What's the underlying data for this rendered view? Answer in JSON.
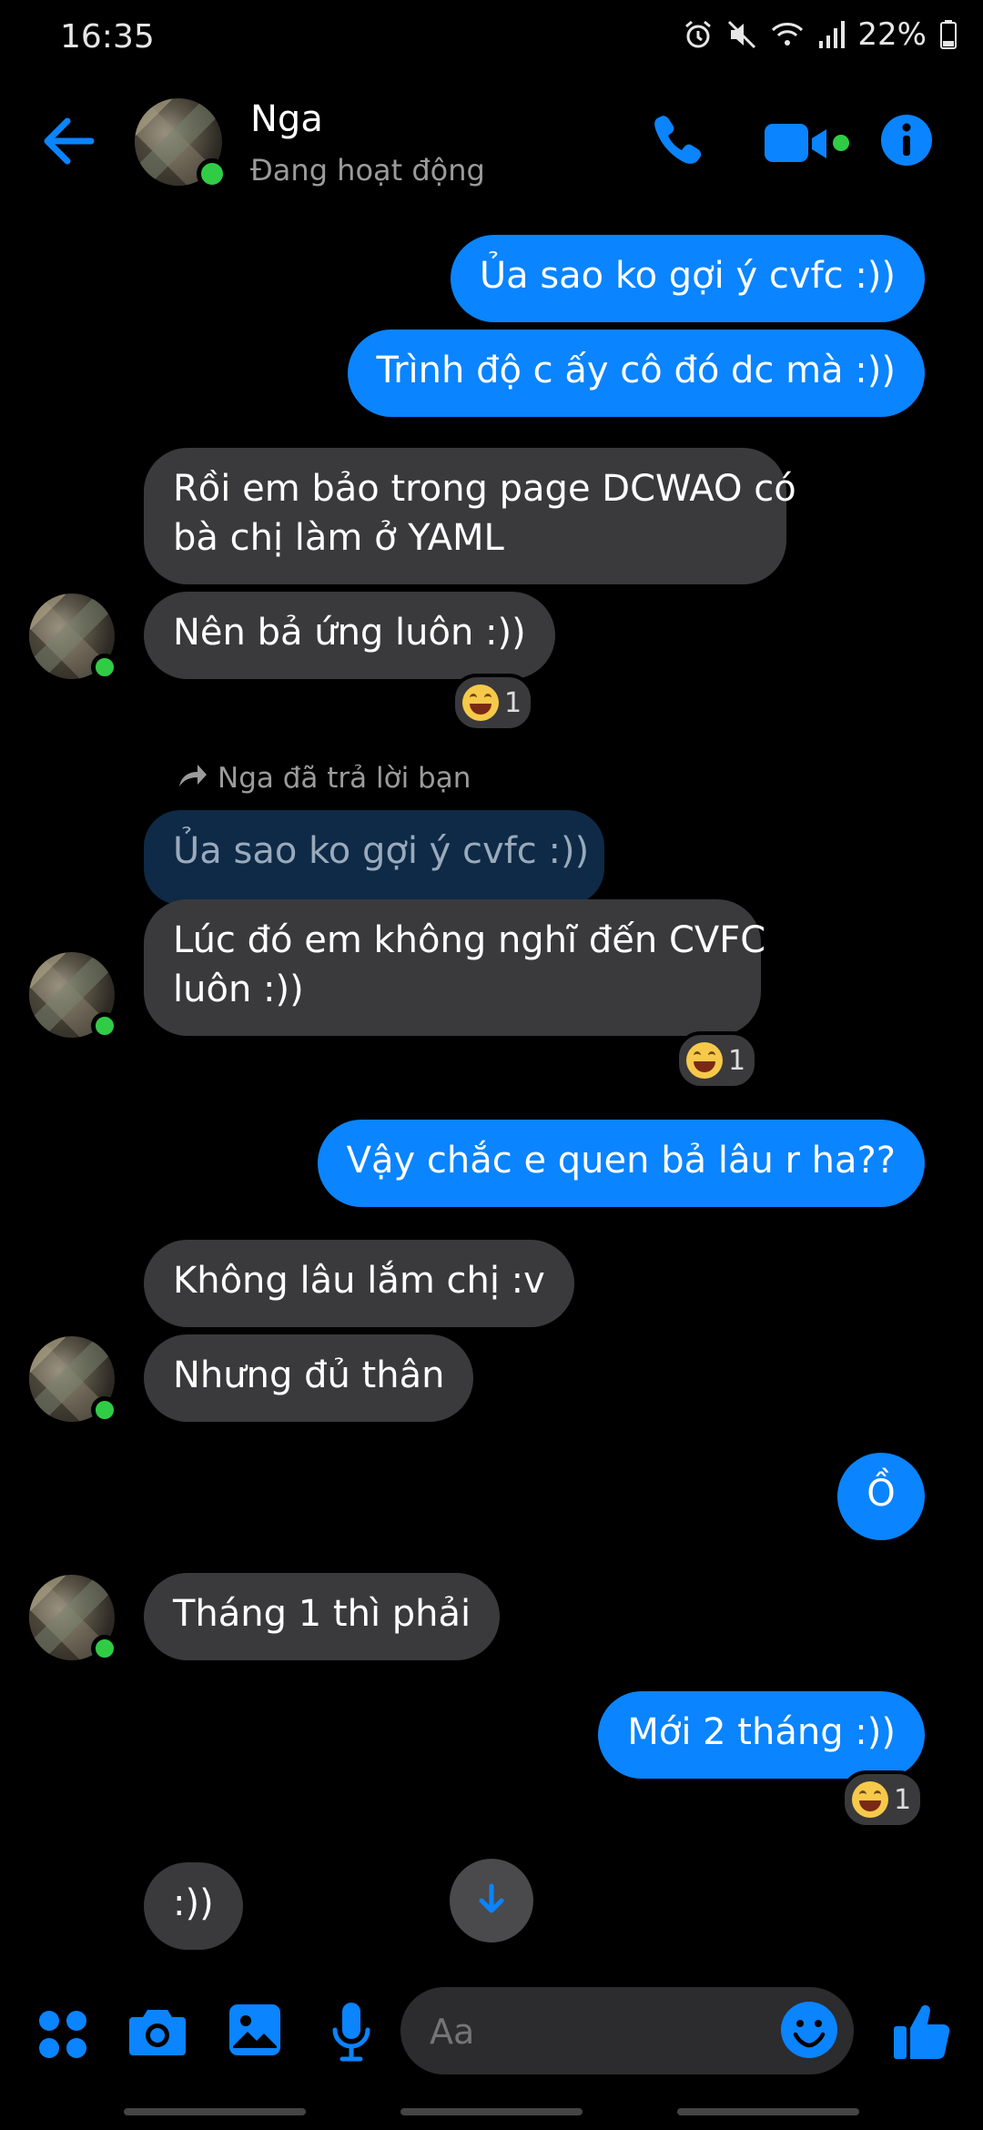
{
  "status_bar": {
    "time": "16:35",
    "battery": "22%",
    "icons": [
      "alarm-icon",
      "mute-icon",
      "wifi-icon",
      "signal-icon",
      "battery-icon"
    ]
  },
  "header": {
    "contact_name": "Nga",
    "contact_status": "Đang hoạt động",
    "icons": [
      "back-arrow-icon",
      "phone-icon",
      "video-camera-icon",
      "info-icon"
    ]
  },
  "colors": {
    "accent": "#0a84ff",
    "outgoing_bubble": "#0a84ff",
    "incoming_bubble": "#3a3a3c",
    "online": "#31cc46",
    "background": "#000000"
  },
  "messages": {
    "m1": "Ủa sao ko gợi ý cvfc :))",
    "m2": "Trình độ c ấy cô đó dc mà :))",
    "m3_line1": "Rồi em bảo trong page DCWAO có",
    "m3_line2": "bà chị làm ở YAML",
    "m4": "Nên bả ứng luôn :))",
    "m4_reaction_count": "1",
    "reply_label": "Nga đã trả lời bạn",
    "reply_quote": "Ủa sao ko gợi ý cvfc :))",
    "m5_line1": "Lúc đó em không nghĩ đến CVFC",
    "m5_line2": "luôn :))",
    "m5_reaction_count": "1",
    "m6": "Vậy chắc e quen bả lâu r ha??",
    "m7": "Không lâu lắm chị :v",
    "m8": "Nhưng đủ thân",
    "m9": "Ồ",
    "m10": "Tháng 1 thì phải",
    "m11": "Mới 2 tháng :))",
    "m11_reaction_count": "1",
    "m12": ":))"
  },
  "composer": {
    "placeholder": "Aa",
    "icons": [
      "apps-icon",
      "camera-icon",
      "gallery-icon",
      "microphone-icon",
      "emoji-icon",
      "like-icon"
    ]
  }
}
